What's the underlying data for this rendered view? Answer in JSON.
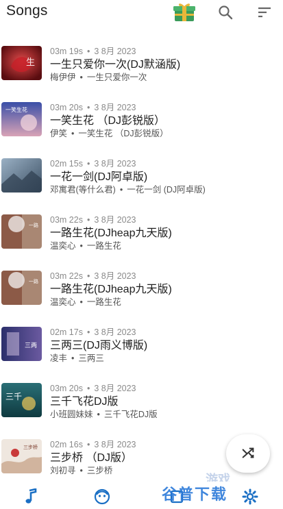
{
  "header": {
    "title": "Songs",
    "icons": [
      "gift-icon",
      "search-icon",
      "sort-icon"
    ]
  },
  "colors": {
    "accent": "#1a6fc4",
    "gift_green": "#3a9b5a",
    "gift_gold": "#e8b73a"
  },
  "songs": [
    {
      "duration": "03m 19s",
      "date": "3 8月 2023",
      "title": "一生只爱你一次(DJ默涵版)",
      "artist": "梅伊伊",
      "album": "一生只爱你一次"
    },
    {
      "duration": "03m 20s",
      "date": "3 8月 2023",
      "title": "一笑生花 （DJ彭锐版）",
      "artist": "伊笑",
      "album": "一笑生花 （DJ彭锐版）"
    },
    {
      "duration": "02m 15s",
      "date": "3 8月 2023",
      "title": "一花一剑(DJ阿卓版)",
      "artist": "邓寓君(等什么君)",
      "album": "一花一剑 (DJ阿卓版)"
    },
    {
      "duration": "03m 22s",
      "date": "3 8月 2023",
      "title": "一路生花(DJheap九天版)",
      "artist": "温奕心",
      "album": "一路生花"
    },
    {
      "duration": "03m 22s",
      "date": "3 8月 2023",
      "title": "一路生花(DJheap九天版)",
      "artist": "温奕心",
      "album": "一路生花"
    },
    {
      "duration": "02m 17s",
      "date": "3 8月 2023",
      "title": "三两三(DJ雨义博版)",
      "artist": "凌丰",
      "album": "三两三"
    },
    {
      "duration": "03m 20s",
      "date": "3 8月 2023",
      "title": "三千飞花DJ版",
      "artist": "小班圆妹妹",
      "album": "三千飞花DJ版"
    },
    {
      "duration": "02m 16s",
      "date": "3 8月 2023",
      "title": "三步桥 （DJ版）",
      "artist": "刘初寻",
      "album": "三步桥"
    }
  ],
  "separator": "•",
  "fab": {
    "icon": "shuffle-icon"
  },
  "bottom_nav": {
    "items": [
      "music-note-icon",
      "face-icon",
      "library-icon",
      "settings-icon"
    ]
  },
  "watermark": {
    "text": "谷普下载",
    "sub": "游戏"
  }
}
